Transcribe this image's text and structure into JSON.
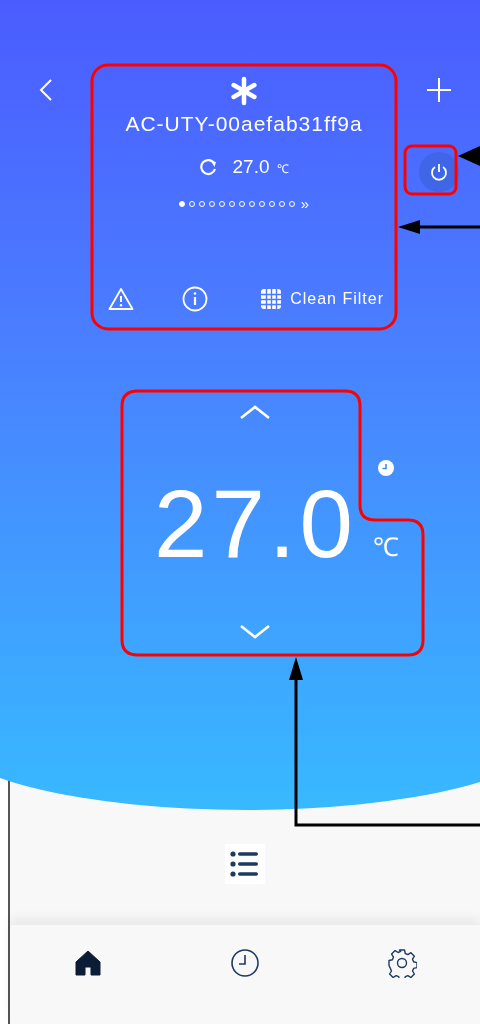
{
  "device": {
    "name": "AC-UTY-00aefab31ff9a",
    "current_temp": "27.0",
    "current_unit": "℃",
    "page_dots": [
      {
        "selected": true
      },
      {
        "selected": false
      },
      {
        "selected": false
      },
      {
        "selected": false
      },
      {
        "selected": false
      },
      {
        "selected": false
      },
      {
        "selected": false
      },
      {
        "selected": false
      },
      {
        "selected": false
      },
      {
        "selected": false
      },
      {
        "selected": false
      },
      {
        "selected": false
      }
    ],
    "more_pages": "»",
    "clean_filter": "Clean Filter"
  },
  "setpoint": {
    "value": "27.0",
    "unit": "℃"
  },
  "nav": [
    {
      "kind": "home",
      "selected": true
    },
    {
      "kind": "history",
      "selected": false
    },
    {
      "kind": "settings",
      "selected": false
    }
  ]
}
